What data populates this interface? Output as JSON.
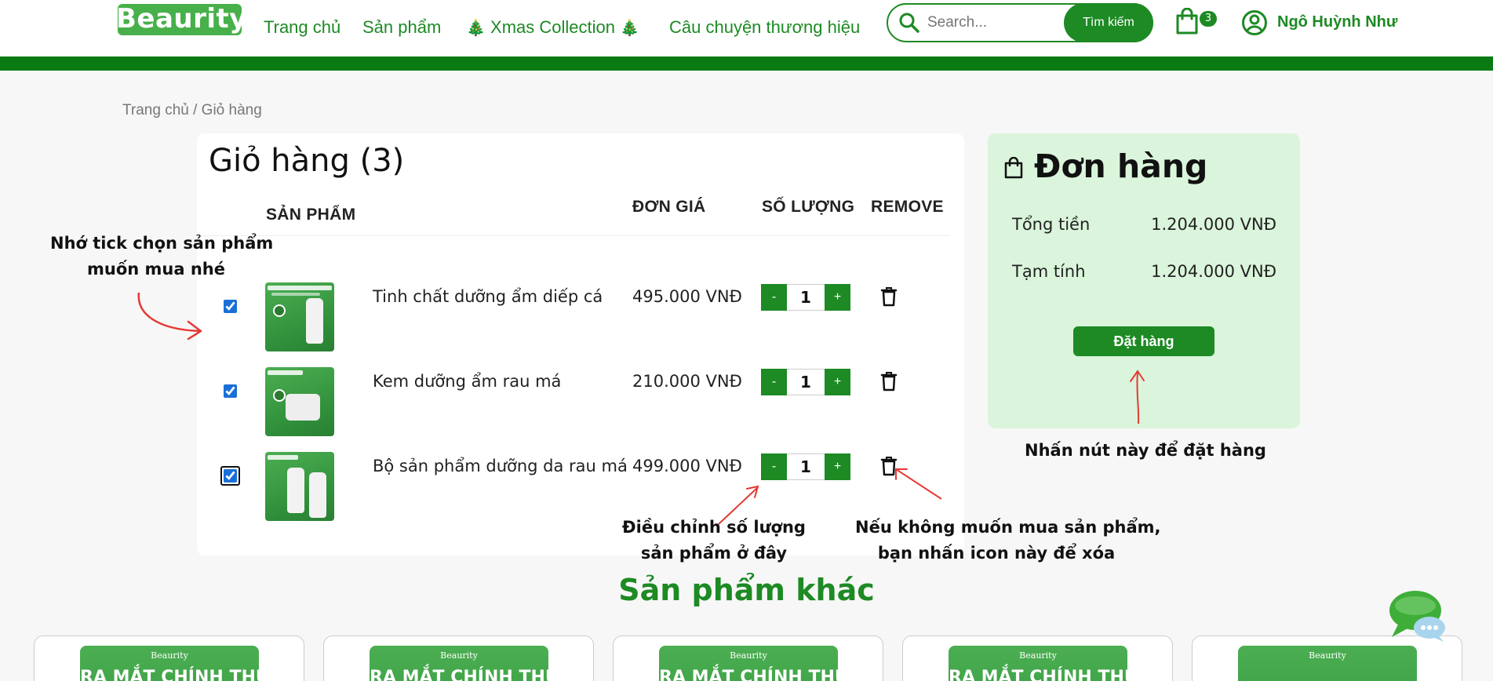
{
  "header": {
    "logo": "Beaurity",
    "nav": [
      "Trang chủ",
      "Sản phẩm",
      "Xmas Collection",
      "Câu chuyện thương hiệu"
    ],
    "search_placeholder": "Search...",
    "search_button": "Tìm kiếm",
    "cart_count": "3",
    "user_name": "Ngô Huỳnh Như",
    "xmas_icon": "christmas-tree-icon"
  },
  "breadcrumb": "Trang chủ / Giỏ hàng",
  "cart": {
    "title": "Giỏ hàng (3)",
    "columns": {
      "product": "SẢN PHẨM",
      "price": "ĐƠN GIÁ",
      "quantity": "SỐ LƯỢNG",
      "remove": "REMOVE"
    },
    "items": [
      {
        "name": "Tinh chất dưỡng ẩm diếp cá",
        "price": "495.000 VNĐ",
        "qty": "1",
        "checked": true
      },
      {
        "name": "Kem dưỡng ẩm rau má",
        "price": "210.000 VNĐ",
        "qty": "1",
        "checked": true
      },
      {
        "name": "Bộ sản phẩm dưỡng da rau má",
        "price": "499.000 VNĐ",
        "qty": "1",
        "checked": true
      }
    ],
    "minus_label": "-",
    "plus_label": "+"
  },
  "order": {
    "title": "Đơn hàng",
    "total_label": "Tổng tiền",
    "total_value": "1.204.000 VNĐ",
    "subtotal_label": "Tạm tính",
    "subtotal_value": "1.204.000 VNĐ",
    "button": "Đặt hàng"
  },
  "annotations": {
    "checkbox_note": [
      "Nhớ tick chọn sản phẩm",
      "muốn mua nhé"
    ],
    "order_note": "Nhấn nút này để đặt hàng",
    "qty_note": [
      "Điều chỉnh số lượng",
      "sản phẩm ở đây"
    ],
    "remove_note": [
      "Nếu không muốn mua sản phẩm,",
      "bạn nhấn icon này để xóa"
    ]
  },
  "other": {
    "title": "Sản phẩm khác",
    "card_logo": "Beaurity",
    "card_banner": "RA MẮT CHÍNH THỨC"
  },
  "colors": {
    "brand_green": "#1d8a24",
    "dark_bar": "#0a7a12",
    "order_bg": "#daf5db",
    "arrow_red": "#e53935"
  }
}
